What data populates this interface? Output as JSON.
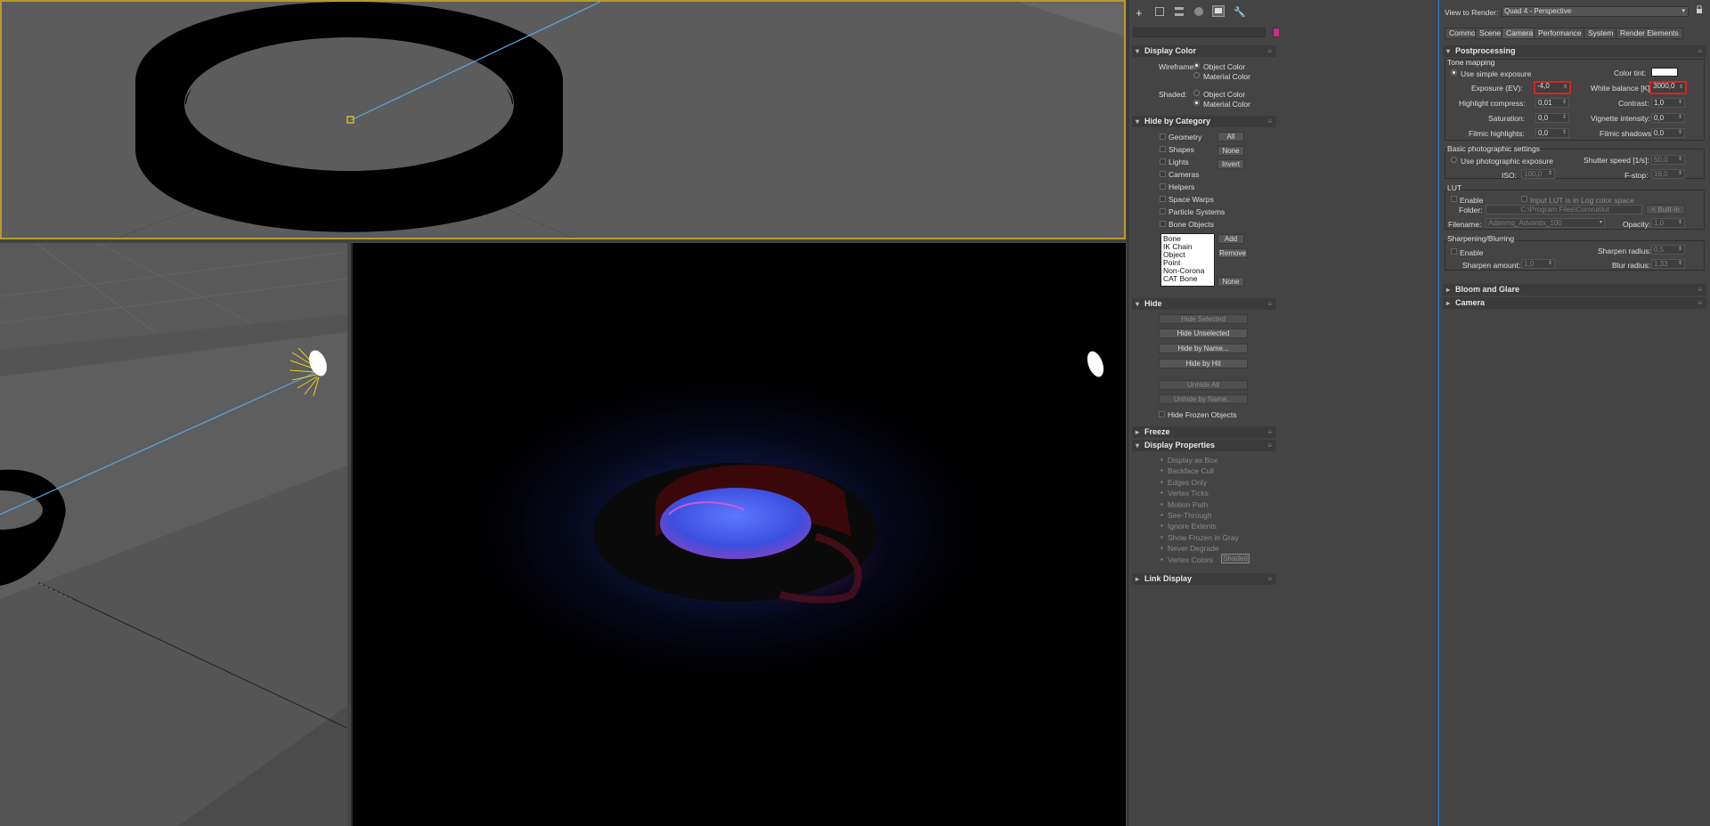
{
  "command_panel": {
    "tabs": [
      "create-icon",
      "modify-icon",
      "hierarchy-icon",
      "motion-icon",
      "display-icon",
      "utilities-icon"
    ],
    "display_color": {
      "title": "Display Color",
      "wireframe_label": "Wireframe:",
      "shaded_label": "Shaded:",
      "object_color": "Object Color",
      "material_color": "Material Color"
    },
    "hide_by_category": {
      "title": "Hide by Category",
      "items": [
        "Geometry",
        "Shapes",
        "Lights",
        "Cameras",
        "Helpers",
        "Space Warps",
        "Particle Systems",
        "Bone Objects"
      ],
      "btn_all": "All",
      "btn_none": "None",
      "btn_invert": "Invert",
      "list": [
        "Bone",
        "IK Chain Object",
        "Point",
        "Non-Corona",
        "CAT Bone"
      ],
      "btn_add": "Add",
      "btn_remove": "Remove",
      "btn_none2": "None"
    },
    "hide": {
      "title": "Hide",
      "hide_selected": "Hide Selected",
      "hide_unselected": "Hide Unselected",
      "hide_by_name": "Hide by Name...",
      "hide_by_hit": "Hide by Hit",
      "unhide_all": "Unhide All",
      "unhide_by_name": "Unhide by Name...",
      "hide_frozen": "Hide Frozen Objects"
    },
    "freeze": {
      "title": "Freeze"
    },
    "display_properties": {
      "title": "Display Properties",
      "items": [
        "Display as Box",
        "Backface Cull",
        "Edges Only",
        "Vertex Ticks",
        "Motion Path",
        "See-Through",
        "Ignore Extents",
        "Show Frozen in Gray",
        "Never Degrade",
        "Vertex Colors"
      ],
      "shaded_btn": "Shaded"
    },
    "link_display": {
      "title": "Link Display"
    }
  },
  "render_setup": {
    "view_to_render_label": "View to Render:",
    "view_to_render_value": "Quad 4 - Perspective",
    "tabs": [
      "Common",
      "Scene",
      "Camera",
      "Performance",
      "System",
      "Render Elements"
    ],
    "active_tab": "Camera",
    "postprocessing": {
      "title": "Postprocessing",
      "tone_mapping": "Tone mapping",
      "use_simple_exposure": "Use simple exposure",
      "color_tint": "Color tint:",
      "exposure_label": "Exposure (EV):",
      "exposure_value": "-4,0",
      "white_balance_label": "White balance [K]:",
      "white_balance_value": "3000,0",
      "highlight_compress_label": "Highlight compress:",
      "highlight_compress_value": "0,01",
      "contrast_label": "Contrast:",
      "contrast_value": "1,0",
      "saturation_label": "Saturation:",
      "saturation_value": "0,0",
      "vignette_label": "Vignette intensity:",
      "vignette_value": "0,0",
      "filmic_highlights_label": "Filmic highlights:",
      "filmic_highlights_value": "0,0",
      "filmic_shadows_label": "Filmic shadows:",
      "filmic_shadows_value": "0,0",
      "basic_photo": "Basic photographic settings",
      "use_photo_exposure": "Use photographic exposure",
      "shutter_label": "Shutter speed [1/s]:",
      "shutter_value": "50,0",
      "iso_label": "ISO:",
      "iso_value": "100,0",
      "fstop_label": "F-stop:",
      "fstop_value": "16,0",
      "lut": "LUT",
      "lut_enable": "Enable",
      "lut_log": "Input LUT is in Log color space",
      "folder_label": "Folder:",
      "folder_value": "C:\\Program Files\\Corona\\lut",
      "builtin": "< Built-in",
      "filename_label": "Filename:",
      "filename_value": "Adanmq_Advantix_100",
      "opacity_label": "Opacity:",
      "opacity_value": "1,0",
      "sharpening": "Sharpening/Blurring",
      "sharp_enable": "Enable",
      "sharpen_radius_label": "Sharpen radius:",
      "sharpen_radius_value": "0,5",
      "sharpen_amount_label": "Sharpen amount:",
      "sharpen_amount_value": "1,0",
      "blur_radius_label": "Blur radius:",
      "blur_radius_value": "1,33"
    },
    "bloom_glare": "Bloom and Glare",
    "camera": "Camera"
  },
  "colors": {
    "swatch": "#cc2a86",
    "viewport_border": "#b59a2c",
    "render_panel_accent": "#2b6fb5",
    "exposure_highlight": "#d42424"
  }
}
